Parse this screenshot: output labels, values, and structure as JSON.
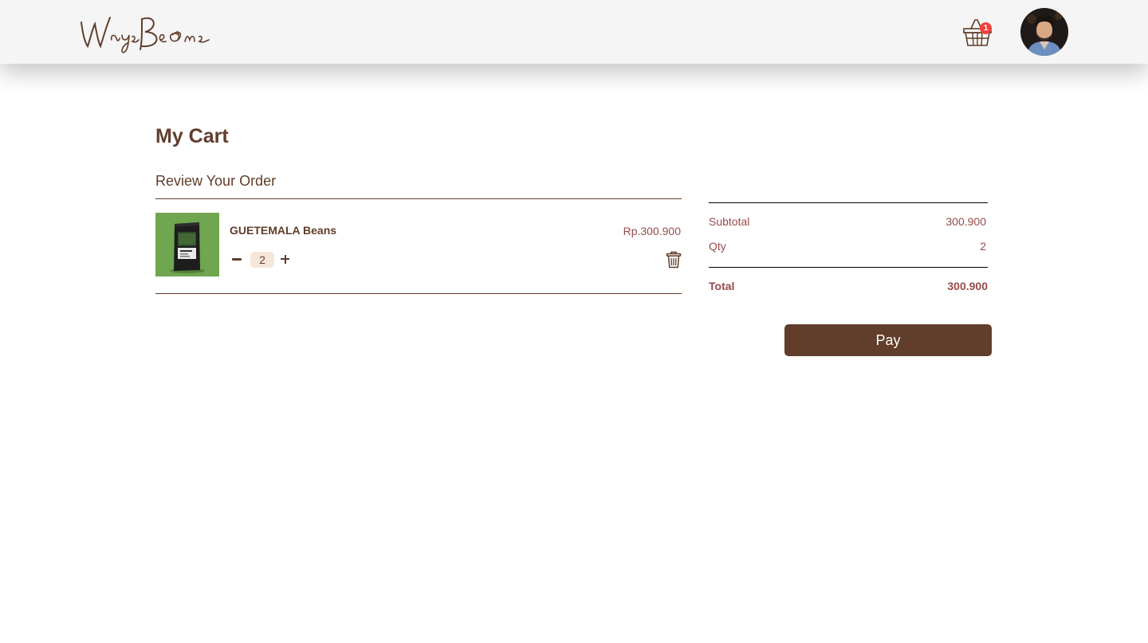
{
  "navbar": {
    "logo_text": "WaysBeans",
    "cart_count": "1"
  },
  "cart": {
    "title": "My Cart",
    "subtitle": "Review Your Order",
    "items": [
      {
        "name": "GUETEMALA Beans",
        "price": "Rp.300.900",
        "qty": "2"
      }
    ]
  },
  "summary": {
    "subtotal_label": "Subtotal",
    "subtotal_value": "300.900",
    "qty_label": "Qty",
    "qty_value": "2",
    "total_label": "Total",
    "total_value": "300.900"
  },
  "actions": {
    "pay_label": "Pay"
  },
  "colors": {
    "brand": "#613D2B",
    "price_text": "#974A4A",
    "badge": "#F13F3F",
    "qty_bg": "#F6E6DA",
    "navbar_bg": "#F5F5F5"
  },
  "icons": [
    "logo",
    "basket-icon",
    "avatar",
    "minus-icon",
    "plus-icon",
    "trash-icon"
  ]
}
